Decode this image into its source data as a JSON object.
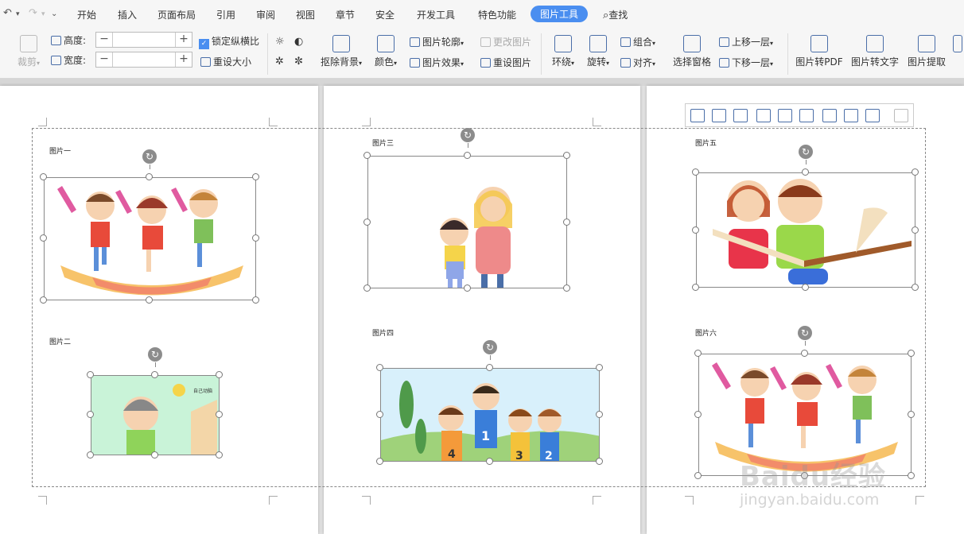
{
  "tabs": [
    "开始",
    "插入",
    "页面布局",
    "引用",
    "审阅",
    "视图",
    "章节",
    "安全",
    "开发工具",
    "特色功能",
    "图片工具"
  ],
  "active_tab": "图片工具",
  "search_label": "查找",
  "ribbon": {
    "crop": "裁剪",
    "height_label": "高度:",
    "width_label": "宽度:",
    "height_value": "",
    "width_value": "",
    "lock_ratio": "锁定纵横比",
    "reset_size": "重设大小",
    "remove_bg": "抠除背景",
    "color": "颜色",
    "outline": "图片轮廓",
    "change_pic": "更改图片",
    "effect": "图片效果",
    "reset_pic": "重设图片",
    "wrap": "环绕",
    "rotate": "旋转",
    "group": "组合",
    "align": "对齐",
    "selection_pane": "选择窗格",
    "bring_forward": "上移一层",
    "send_backward": "下移一层",
    "to_pdf": "图片转PDF",
    "to_text": "图片转文字",
    "extract": "图片提取"
  },
  "captions": [
    "图片一",
    "图片二",
    "图片三",
    "图片四",
    "图片五",
    "图片六"
  ],
  "image_texts": {
    "pic2_bubble": "自己动脑"
  },
  "watermark": {
    "main": "Baidu经验",
    "url": "jingyan.baidu.com"
  },
  "colors": {
    "accent": "#4a8ef0",
    "sky": "#d8f0fb",
    "mint": "#c9f3d8"
  }
}
